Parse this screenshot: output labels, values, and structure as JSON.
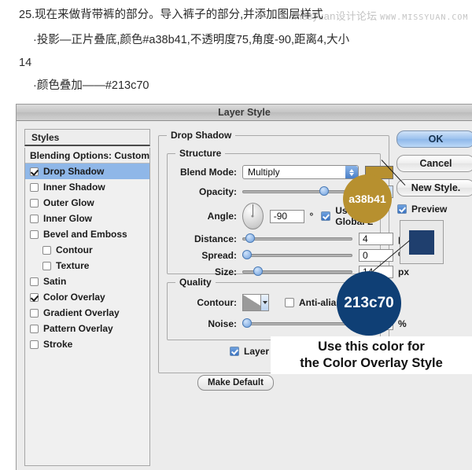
{
  "tutorial": {
    "line0": "25.现在来做背带裤的部分。导入裤子的部分,并添加图层样式",
    "line1": "·投影—正片叠底,颜色#a38b41,不透明度75,角度-90,距离4,大小",
    "line2": "14",
    "line3": "·颜色叠加——#213c70",
    "watermark_cn": "missyuan设计论坛",
    "watermark_site": "WWW.MISSYUAN.COM"
  },
  "dialog": {
    "title": "Layer Style",
    "styles_header": "Styles",
    "styles": [
      {
        "label": "Blending Options: Custom",
        "checkbox": false,
        "checked": false,
        "selected": false,
        "indent": false,
        "header": true
      },
      {
        "label": "Drop Shadow",
        "checkbox": true,
        "checked": true,
        "selected": true,
        "indent": false,
        "header": false
      },
      {
        "label": "Inner Shadow",
        "checkbox": true,
        "checked": false,
        "selected": false,
        "indent": false,
        "header": false
      },
      {
        "label": "Outer Glow",
        "checkbox": true,
        "checked": false,
        "selected": false,
        "indent": false,
        "header": false
      },
      {
        "label": "Inner Glow",
        "checkbox": true,
        "checked": false,
        "selected": false,
        "indent": false,
        "header": false
      },
      {
        "label": "Bevel and Emboss",
        "checkbox": true,
        "checked": false,
        "selected": false,
        "indent": false,
        "header": false
      },
      {
        "label": "Contour",
        "checkbox": true,
        "checked": false,
        "selected": false,
        "indent": true,
        "header": false
      },
      {
        "label": "Texture",
        "checkbox": true,
        "checked": false,
        "selected": false,
        "indent": true,
        "header": false
      },
      {
        "label": "Satin",
        "checkbox": true,
        "checked": false,
        "selected": false,
        "indent": false,
        "header": false
      },
      {
        "label": "Color Overlay",
        "checkbox": true,
        "checked": true,
        "selected": false,
        "indent": false,
        "header": false
      },
      {
        "label": "Gradient Overlay",
        "checkbox": true,
        "checked": false,
        "selected": false,
        "indent": false,
        "header": false
      },
      {
        "label": "Pattern Overlay",
        "checkbox": true,
        "checked": false,
        "selected": false,
        "indent": false,
        "header": false
      },
      {
        "label": "Stroke",
        "checkbox": true,
        "checked": false,
        "selected": false,
        "indent": false,
        "header": false
      }
    ],
    "drop_shadow": {
      "group_label": "Drop Shadow",
      "structure_label": "Structure",
      "blend_mode_label": "Blend Mode:",
      "blend_mode_value": "Multiply",
      "shadow_color": "#b7902f",
      "opacity_label": "Opacity:",
      "opacity_value": "75",
      "opacity_unit": "%",
      "angle_label": "Angle:",
      "angle_value": "-90",
      "angle_unit": "°",
      "use_global_light_label": "Use Global L",
      "use_global_light_checked": true,
      "distance_label": "Distance:",
      "distance_value": "4",
      "distance_unit": "px",
      "spread_label": "Spread:",
      "spread_value": "0",
      "spread_unit": "%",
      "size_label": "Size:",
      "size_value": "14",
      "size_unit": "px"
    },
    "quality": {
      "group_label": "Quality",
      "contour_label": "Contour:",
      "anti_aliased_label": "Anti-aliased",
      "anti_aliased_checked": false,
      "noise_label": "Noise:",
      "noise_value": "0",
      "noise_unit": "%"
    },
    "footer": {
      "layer_knocks_label": "Layer Kno",
      "layer_knocks_checked": true,
      "make_default_label": "Make Default"
    },
    "buttons": {
      "ok": "OK",
      "cancel": "Cancel",
      "new_style": "New Style.",
      "preview_label": "Preview",
      "preview_checked": true,
      "preview_swatch_color": "#1f3f6e"
    }
  },
  "annotations": {
    "gold_badge": "a38b41",
    "gold_badge_color": "#b7902f",
    "blue_badge": "213c70",
    "blue_badge_color": "#0f3f75",
    "callout_line1": "Use this color for",
    "callout_line2": "the Color Overlay Style"
  }
}
